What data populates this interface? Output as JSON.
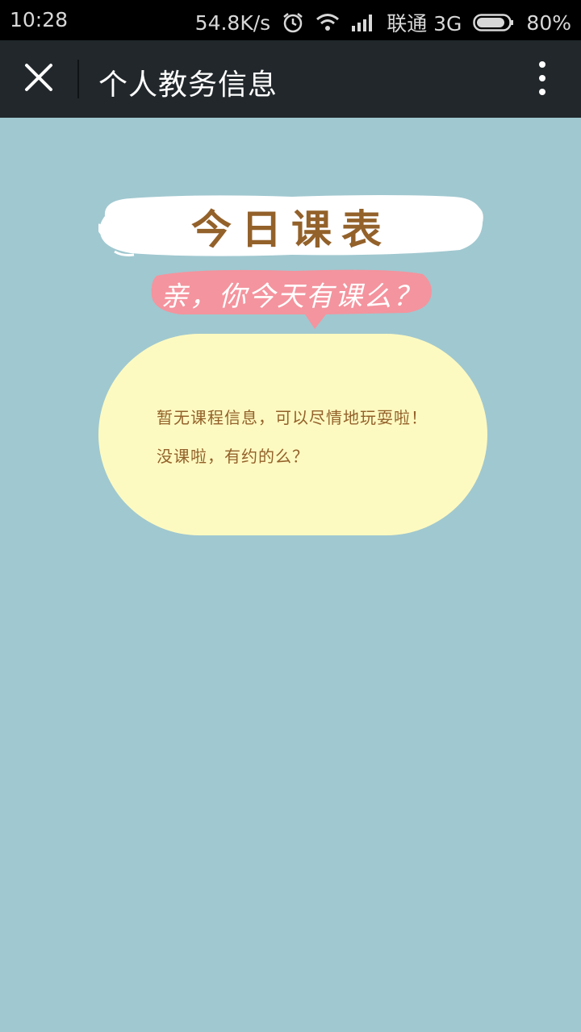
{
  "status_bar": {
    "time": "10:28",
    "speed": "54.8K/s",
    "carrier": "联通 3G",
    "battery": "80%",
    "icons": [
      "alarm-icon",
      "wifi-icon",
      "signal-icon",
      "battery-icon"
    ]
  },
  "title_bar": {
    "title": "个人教务信息",
    "close_icon": "close-icon",
    "more_icon": "more-vertical-icon"
  },
  "banner": {
    "title": "今日课表",
    "subtitle": "亲，你今天有课么？"
  },
  "info": {
    "line1": "暂无课程信息，可以尽情地玩耍啦！",
    "line2": "没课啦，有约的么？"
  },
  "colors": {
    "background": "#a0c8d0",
    "title_bar": "#21272b",
    "bubble": "#fdfac1",
    "text_brown": "#93612a",
    "pink": "#f4949e"
  }
}
